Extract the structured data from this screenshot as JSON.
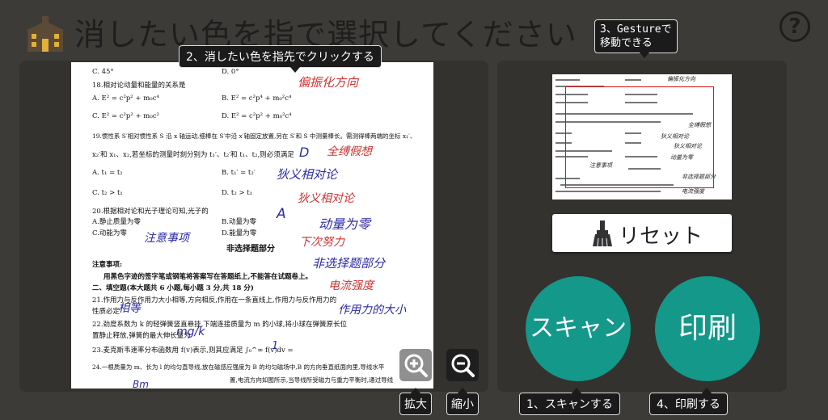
{
  "header": {
    "title": "消したい色を指で選択してください",
    "icon": "school-icon",
    "help_label": "?"
  },
  "tooltips": {
    "select_color": "2、消したい色を指先でクリックする",
    "gesture_line1": "3、Gestureで",
    "gesture_line2": "移動できる",
    "scan": "1、スキャンする",
    "print": "4、印刷する",
    "zoom_in": "拡大",
    "zoom_out": "縮小"
  },
  "buttons": {
    "reset_label": "リセット",
    "scan_label": "スキャン",
    "print_label": "印刷"
  },
  "document": {
    "printed_lines": [
      "C. 45°",
      "D. 0°",
      "18.相对论动量和能量的关系是",
      "A. E² = c²p² + m₀c⁴",
      "B. E² = c²p⁴ + m₀²c⁴",
      "C. E² = c²p² + m₀c²",
      "D. E² = c²p² + m₀²c⁴",
      "19.惯性系 S′相对惯性系 S 沿 x 轴运动,细棒在 S′中沿 x′轴固定放置,另在 S′和 S 中测量棒长。需测得棒两端的坐标 x₁′、",
      "x₂′和 x₁、x₂,若坐标的测量时刻分别为 t₁′、t₂′和 t₁、t₂,则必须满足",
      "A. t₁ = t₂",
      "B. t₁′ = t₂′",
      "C. t₂ > t₁",
      "D. t₂ > t₁",
      "20.根据相对论和光子理论可知,光子的",
      "A.静止质量为零",
      "B.动量为零",
      "C.动能为零",
      "D.能量为零",
      "非选择题部分",
      "注意事项:",
      "用黑色字迹的签字笔或钢笔将答案写在答题纸上,不能答在试题卷上。",
      "二、填空题(本大题共 6 小题,每小题 3 分,共 18 分)",
      "21.作用力与反作用力大小相等,方向相反,作用在一条直线上,作用力与反作用力的",
      "性质必定",
      "22.劲度系数为 k 的轻弹簧竖直悬挂,下端连接质量为 m 的小球,将小球在弹簧原长位",
      "置静止释放,弹簧的最大伸长量为",
      "23.麦克斯韦速率分布函数用 f(v)表示,则其应满足 ∫₀^∞ f(v)dv =",
      "24.一根质量为 m、长为 l 的均匀直导线,放在磁感应强度为 B 的均匀磁场中,B 的方向垂直纸面向里,导线水平",
      "置,电流方向如图所示,当导线所受磁力与重力平衡时,通过导线"
    ],
    "handwritten_notes": [
      "偏振化方向",
      "D",
      "全缚假想",
      "狄义相对论",
      "动量为零",
      "注意事项",
      "下次努力",
      "非选择题部分",
      "电流强度",
      "作用力的大小",
      "相等",
      "mg/k",
      "1",
      "A",
      "Bm"
    ]
  },
  "colors": {
    "background": "#3d3b38",
    "panel": "#34322f",
    "accent_teal": "#13988a",
    "tooltip_bg": "#1b1b1b",
    "handwriting_red": "#cc3333",
    "handwriting_blue": "#2a2aa8",
    "viewport_red": "#dd1111"
  }
}
